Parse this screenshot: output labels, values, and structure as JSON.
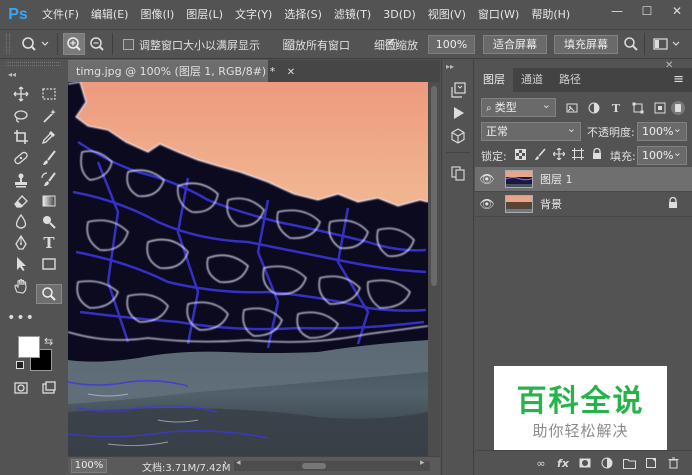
{
  "app": {
    "logo": "Ps"
  },
  "menu": [
    "文件(F)",
    "编辑(E)",
    "图像(I)",
    "图层(L)",
    "文字(Y)",
    "选择(S)",
    "滤镜(T)",
    "3D(D)",
    "视图(V)",
    "窗口(W)",
    "帮助(H)"
  ],
  "window_controls": {
    "minimize": "—",
    "maximize": "☐",
    "close": "✕"
  },
  "options": {
    "resize_windows_label": "调整窗口大小以满屏显示",
    "resize_windows_checked": false,
    "zoom_all_label": "缩放所有窗口",
    "zoom_all_checked": false,
    "scrubby_zoom_label": "细微缩放",
    "scrubby_zoom_checked": true,
    "zoom_value": "100%",
    "fit_screen_label": "适合屏幕",
    "fill_screen_label": "填充屏幕"
  },
  "document": {
    "tab_title": "timg.jpg @ 100% (图层 1, RGB/8#) *",
    "tab_close": "✕",
    "status_zoom": "100%",
    "status_doc": "文档:3.71M/7.42M"
  },
  "panel": {
    "tabs": [
      "图层",
      "通道",
      "路径"
    ],
    "active_tab": 0,
    "filter_kind": "类型",
    "blend_mode": "正常",
    "opacity_label": "不透明度:",
    "opacity_value": "100%",
    "lock_label": "锁定:",
    "fill_label": "填充:",
    "fill_value": "100%",
    "layers": [
      {
        "name": "图层 1",
        "selected": true,
        "locked": false
      },
      {
        "name": "背景",
        "selected": false,
        "locked": true
      }
    ],
    "bottom_fx": "fx"
  },
  "watermark": {
    "title": "百科全说",
    "subtitle": "助你轻松解决"
  },
  "colors": {
    "ps_blue": "#31a8ff",
    "chrome": "#535353",
    "watermark_green": "#27b34a",
    "watermark_gray": "#8a8a8a"
  }
}
